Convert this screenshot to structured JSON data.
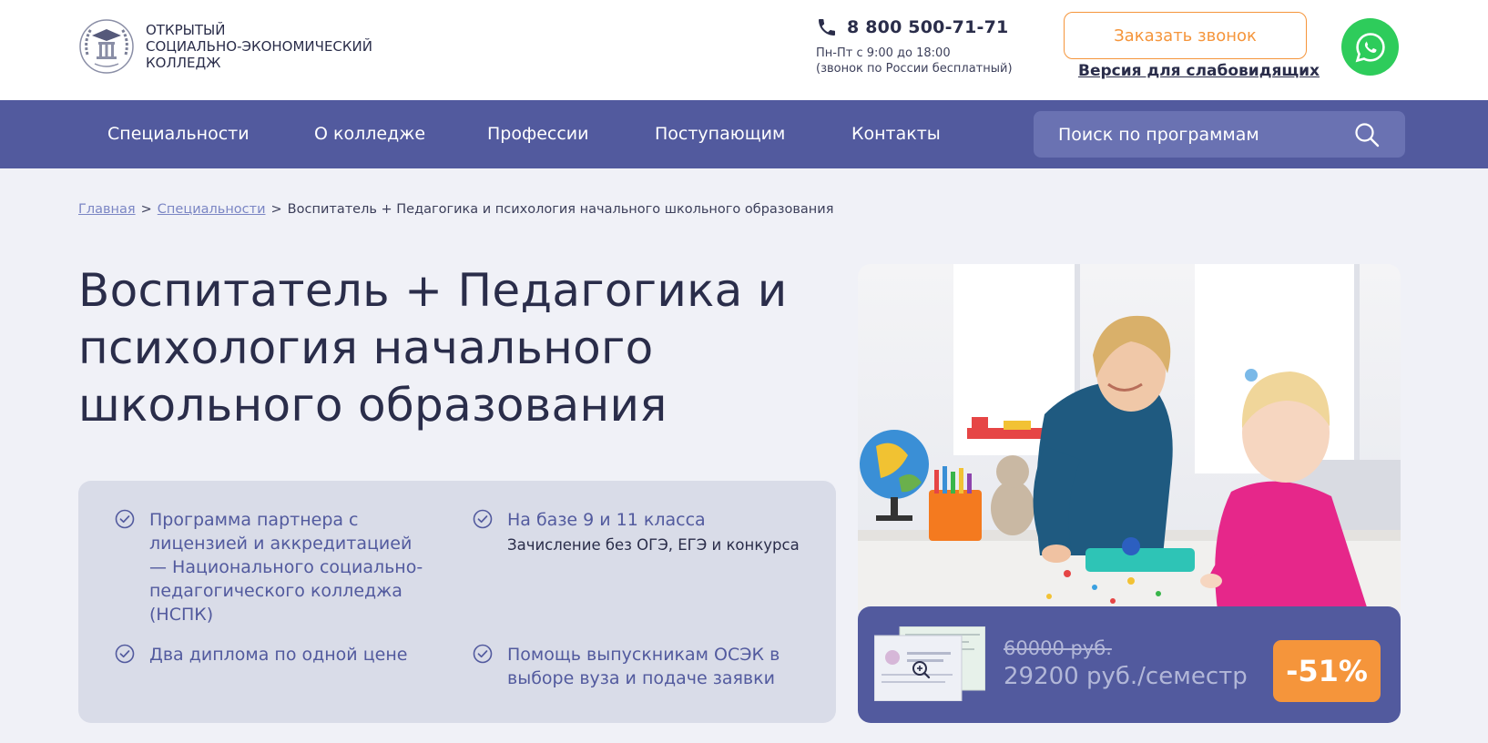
{
  "header": {
    "logo_lines": [
      "Открытый",
      "социально-экономический",
      "колледж"
    ],
    "phone": "8 800 500-71-71",
    "hours_line1": "Пн-Пт с 9:00 до 18:00",
    "hours_line2": "(звонок по России бесплатный)",
    "call_button": "Заказать звонок",
    "accessibility_link": "Версия для слабовидящих"
  },
  "nav": {
    "items": [
      {
        "label": "Специальности"
      },
      {
        "label": "О колледже"
      },
      {
        "label": "Профессии"
      },
      {
        "label": "Поступающим"
      },
      {
        "label": "Контакты"
      }
    ],
    "search_placeholder": "Поиск по программам"
  },
  "breadcrumb": {
    "home": "Главная",
    "specialties": "Специальности",
    "current": "Воспитатель + Педагогика и психология начального школьного образования",
    "separator": ">"
  },
  "page_title": "Воспитатель + Педагогика и психология начального школьного образования",
  "features": [
    {
      "title": "Программа партнера с лицензией и аккредитацией — Национального социально-педагогического колледжа (НСПК)",
      "sub": ""
    },
    {
      "title": "На базе 9 и 11 класса",
      "sub": "Зачисление без ОГЭ, ЕГЭ и конкурса"
    },
    {
      "title": "Два диплома по одной цене",
      "sub": ""
    },
    {
      "title": "Помощь выпускникам ОСЭК в выборе вуза и подаче заявки",
      "sub": ""
    }
  ],
  "price": {
    "old": "60000 руб.",
    "new": "29200 руб./семестр",
    "discount": "-51%"
  },
  "colors": {
    "nav_bg": "#525a9e",
    "accent_orange": "#f5953b",
    "whatsapp_green": "#2ecc5b",
    "page_bg": "#f0f1f7"
  }
}
